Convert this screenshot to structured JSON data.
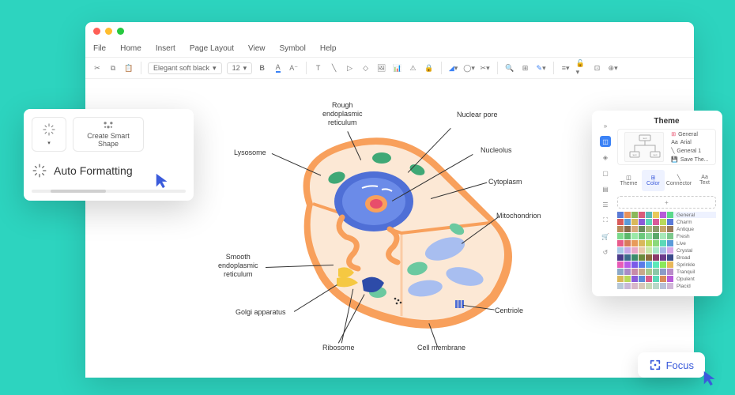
{
  "menubar": [
    "File",
    "Home",
    "Insert",
    "Page Layout",
    "View",
    "Symbol",
    "Help"
  ],
  "toolbar": {
    "font": "Elegant soft black",
    "size": "12"
  },
  "cell_labels": {
    "rough_er": "Rough\nendoplasmic\nreticulum",
    "nuclear_pore": "Nuclear pore",
    "lysosome": "Lysosome",
    "nucleolus": "Nucleolus",
    "cytoplasm": "Cytoplasm",
    "mitochondrion": "Mitochondrion",
    "smooth_er": "Smooth\nendoplasmic\nreticulum",
    "golgi": "Golgi apparatus",
    "ribosome": "Ribosome",
    "cell_membrane": "Cell membrane",
    "centriole": "Centriole"
  },
  "popup": {
    "smart_shape": "Create Smart\nShape",
    "auto_formatting": "Auto Formatting"
  },
  "theme": {
    "title": "Theme",
    "opts": [
      "General",
      "Arial",
      "General 1",
      "Save The..."
    ],
    "tabs": [
      "Theme",
      "Color",
      "Connector",
      "Text"
    ],
    "palettes": [
      "General",
      "Charm",
      "Antique",
      "Fresh",
      "Live",
      "Crystal",
      "Broad",
      "Sprinkle",
      "Tranquil",
      "Opulent",
      "Placid"
    ]
  },
  "focus": {
    "label": "Focus"
  }
}
